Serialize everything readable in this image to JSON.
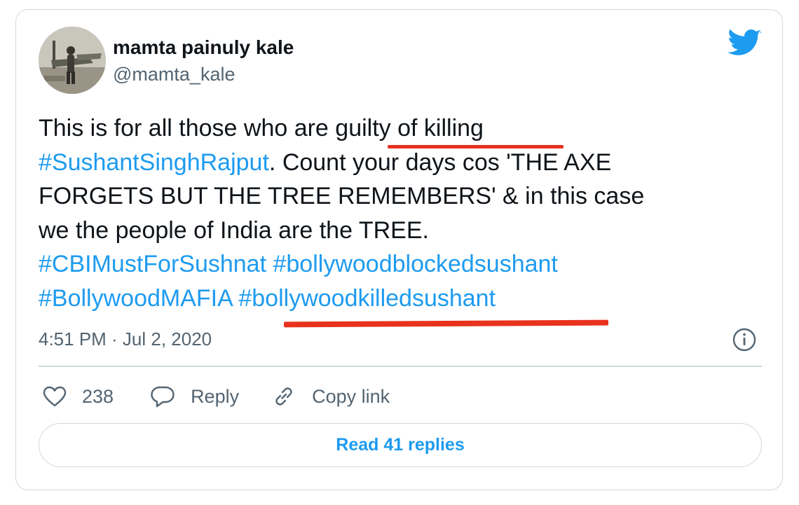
{
  "author": {
    "display_name": "mamta painuly kale",
    "handle": "@mamta_kale"
  },
  "tweet": {
    "lines": [
      [
        {
          "text": "This is for all those who are guilty of killing",
          "hashtag": false
        }
      ],
      [
        {
          "text": "#SushantSinghRajput",
          "hashtag": true
        },
        {
          "text": ".  Count your days cos 'THE AXE",
          "hashtag": false
        }
      ],
      [
        {
          "text": "FORGETS BUT THE TREE REMEMBERS' & in this case",
          "hashtag": false
        }
      ],
      [
        {
          "text": "we the people of India are the TREE.",
          "hashtag": false
        }
      ],
      [
        {
          "text": "#CBIMustForSushnat",
          "hashtag": true
        },
        {
          "text": " ",
          "hashtag": false
        },
        {
          "text": "#bollywoodblockedsushant",
          "hashtag": true
        }
      ],
      [
        {
          "text": "#BollywoodMAFIA",
          "hashtag": true
        },
        {
          "text": " ",
          "hashtag": false
        },
        {
          "text": "#bollywoodkilledsushant",
          "hashtag": true
        }
      ]
    ],
    "timestamp": "4:51 PM · Jul 2, 2020"
  },
  "actions": {
    "like_count": "238",
    "reply_label": "Reply",
    "copy_link_label": "Copy link"
  },
  "read_replies_label": "Read 41 replies",
  "colors": {
    "accent": "#1d9bf0",
    "text": "#0f1419",
    "secondary": "#536471",
    "annotation": "#e8321e"
  },
  "icons": [
    "twitter-bird-icon",
    "info-icon",
    "heart-icon",
    "reply-bubble-icon",
    "link-icon"
  ]
}
